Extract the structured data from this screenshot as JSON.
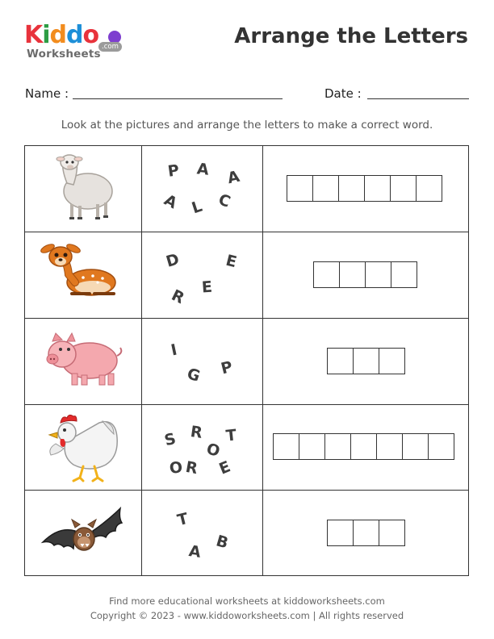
{
  "logo": {
    "letters": [
      {
        "ch": "K",
        "color": "#e8333c"
      },
      {
        "ch": "i",
        "color": "#2d9d44"
      },
      {
        "ch": "d",
        "color": "#f28c1e"
      },
      {
        "ch": "d",
        "color": "#1d8fd8"
      },
      {
        "ch": "o",
        "color": "#e8333c"
      }
    ],
    "subtitle": "Worksheets",
    "domain_badge": ".com"
  },
  "header": {
    "title": "Arrange the Letters"
  },
  "fields": {
    "name_label": "Name :",
    "date_label": "Date :"
  },
  "instructions": "Look at the pictures and arrange the letters to make a correct word.",
  "rows": [
    {
      "picture": "alpaca-icon",
      "letters": [
        "P",
        "A",
        "A",
        "A",
        "L",
        "C"
      ],
      "answer_boxes": 6
    },
    {
      "picture": "deer-icon",
      "letters": [
        "D",
        "E",
        "E",
        "R"
      ],
      "answer_boxes": 4
    },
    {
      "picture": "pig-icon",
      "letters": [
        "I",
        "G",
        "P"
      ],
      "answer_boxes": 3
    },
    {
      "picture": "rooster-icon",
      "letters": [
        "S",
        "R",
        "T",
        "O",
        "O",
        "R",
        "E"
      ],
      "answer_boxes": 7
    },
    {
      "picture": "bat-icon",
      "letters": [
        "T",
        "B",
        "A"
      ],
      "answer_boxes": 3
    }
  ],
  "footer": {
    "line1": "Find more educational worksheets at kiddoworksheets.com",
    "line2": "Copyright © 2023 - www.kiddoworksheets.com  |  All rights reserved"
  }
}
